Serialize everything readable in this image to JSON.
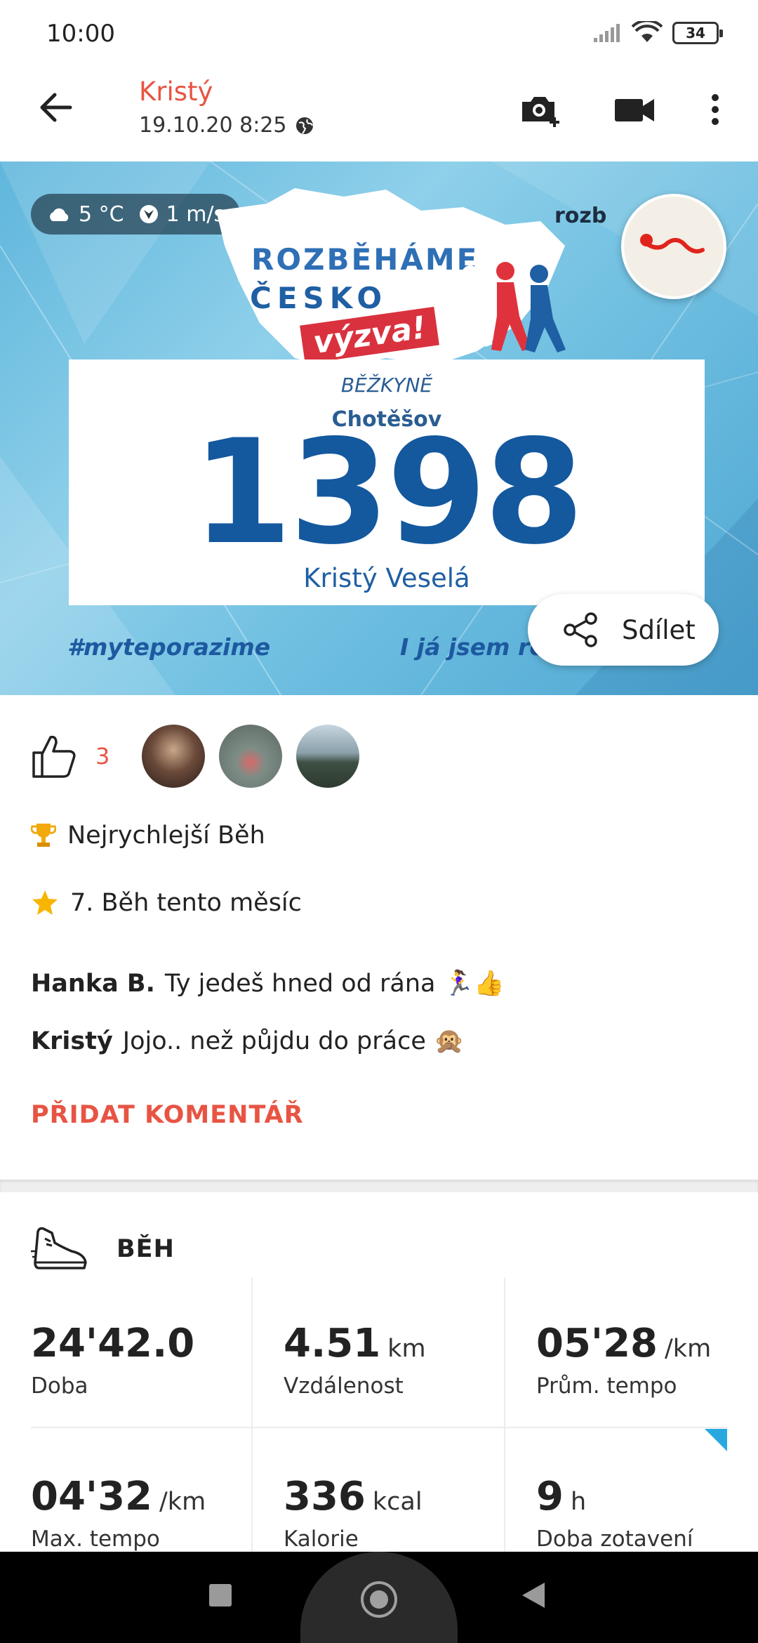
{
  "status_bar": {
    "time": "10:00",
    "battery": "34"
  },
  "header": {
    "name": "Kristý",
    "datetime": "19.10.20 8:25"
  },
  "hero": {
    "weather_temp": "5 °C",
    "weather_wind": "1 m/s",
    "logo_line1": "ROZBĚHÁME",
    "logo_line2": "ČESKO",
    "logo_badge": "výzva!",
    "brand_mark": "rozb",
    "bib_role": "BĚŽKYNĚ",
    "bib_city": "Chotěšov",
    "bib_number": "1398",
    "bib_name": "Kristý Veselá",
    "tag_left": "#myteporazime",
    "tag_right": "I já jsem ro",
    "share_label": "Sdílet"
  },
  "likes": {
    "count": "3"
  },
  "achievements": [
    {
      "icon": "trophy-icon",
      "text": "Nejrychlejší Běh"
    },
    {
      "icon": "star-icon",
      "text": "7. Běh tento měsíc"
    }
  ],
  "comments": [
    {
      "author": "Hanka B.",
      "text": "Ty jedeš hned od rána 🏃‍♀️👍"
    },
    {
      "author": "Kristý",
      "text": "Jojo.. než půjdu do práce 🙊"
    }
  ],
  "add_comment_label": "PŘIDAT KOMENTÁŘ",
  "activity": {
    "sport": "BĚH",
    "stats": [
      {
        "value": "24'42.0",
        "unit": "",
        "label": "Doba"
      },
      {
        "value": "4.51",
        "unit": "km",
        "label": "Vzdálenost"
      },
      {
        "value": "05'28",
        "unit": "/km",
        "label": "Prům. tempo"
      },
      {
        "value": "04'32",
        "unit": "/km",
        "label": "Max. tempo"
      },
      {
        "value": "336",
        "unit": "kcal",
        "label": "Kalorie"
      },
      {
        "value": "9",
        "unit": "h",
        "label": "Doba zotavení"
      }
    ]
  },
  "colors": {
    "accent": "#e85443",
    "bib_blue": "#14589e",
    "flag_blue": "#29a8e0"
  }
}
